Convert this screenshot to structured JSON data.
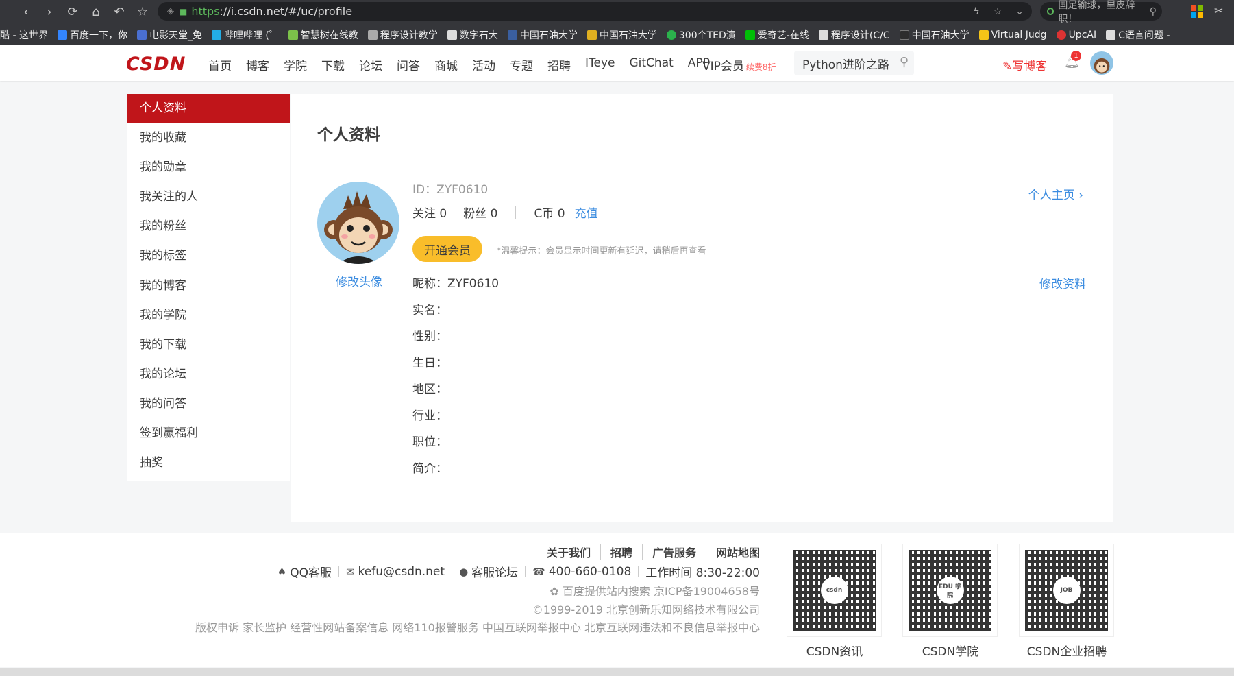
{
  "browser": {
    "url_scheme": "https",
    "url_rest": "://i.csdn.net/#/uc/profile",
    "search_placeholder": "国足输球，里皮辞职！",
    "bookmarks": [
      "酷 - 这世界",
      "百度一下，你",
      "电影天堂_免",
      "哔哩哔哩 (゜",
      "智慧树在线教",
      "程序设计教学",
      "数字石大",
      "中国石油大学",
      "中国石油大学",
      "300个TED演",
      "爱奇艺-在线",
      "程序设计(C/C",
      "中国石油大学",
      "Virtual Judg",
      "UpcAI",
      "C语言问题 - "
    ]
  },
  "nav": {
    "logo": "CSDN",
    "links": [
      "首页",
      "博客",
      "学院",
      "下载",
      "论坛",
      "问答",
      "商城",
      "活动",
      "专题",
      "招聘",
      "ITeye",
      "GitChat",
      "APP"
    ],
    "vip": "VIP会员",
    "vip_promo": "续费8折",
    "search_value": "Python进阶之路",
    "write": "写博客",
    "notif_count": "1"
  },
  "sidebar": {
    "group1": [
      "个人资料",
      "我的收藏",
      "我的勋章",
      "我关注的人",
      "我的粉丝",
      "我的标签"
    ],
    "group2": [
      "我的博客",
      "我的学院",
      "我的下载",
      "我的论坛",
      "我的问答",
      "签到赢福利",
      "抽奖"
    ]
  },
  "profile": {
    "title": "个人资料",
    "id_label": "ID：",
    "id": "ZYF0610",
    "follow_label": "关注",
    "follow": "0",
    "fans_label": "粉丝",
    "fans": "0",
    "coin_label": "C币",
    "coin": "0",
    "charge": "充值",
    "vip_button": "开通会员",
    "tip": "*温馨提示：会员显示时间更新有延迟，请稍后再查看",
    "home_link": "个人主页",
    "edit_avatar": "修改头像",
    "edit_profile": "修改资料",
    "fields": [
      {
        "label": "昵称：",
        "value": "ZYF0610"
      },
      {
        "label": "实名：",
        "value": ""
      },
      {
        "label": "性别：",
        "value": ""
      },
      {
        "label": "生日：",
        "value": ""
      },
      {
        "label": "地区：",
        "value": ""
      },
      {
        "label": "行业：",
        "value": ""
      },
      {
        "label": "职位：",
        "value": ""
      },
      {
        "label": "简介：",
        "value": ""
      }
    ]
  },
  "footer": {
    "links": [
      "关于我们",
      "招聘",
      "广告服务",
      "网站地图"
    ],
    "qq": "QQ客服",
    "email": "kefu@csdn.net",
    "forum": "客服论坛",
    "phone": "400-660-0108",
    "hours": "工作时间 8:30-22:00",
    "icp": "百度提供站内搜索 京ICP备19004658号",
    "copyright": "©1999-2019 北京创新乐知网络技术有限公司",
    "bottom": "版权申诉 家长监护 经营性网站备案信息 网络110报警服务 中国互联网举报中心 北京互联网违法和不良信息举报中心",
    "qrs": [
      {
        "label": "CSDN资讯",
        "center": "csdn"
      },
      {
        "label": "CSDN学院",
        "center": "EDU 学院"
      },
      {
        "label": "CSDN企业招聘",
        "center": "JOB"
      }
    ]
  }
}
